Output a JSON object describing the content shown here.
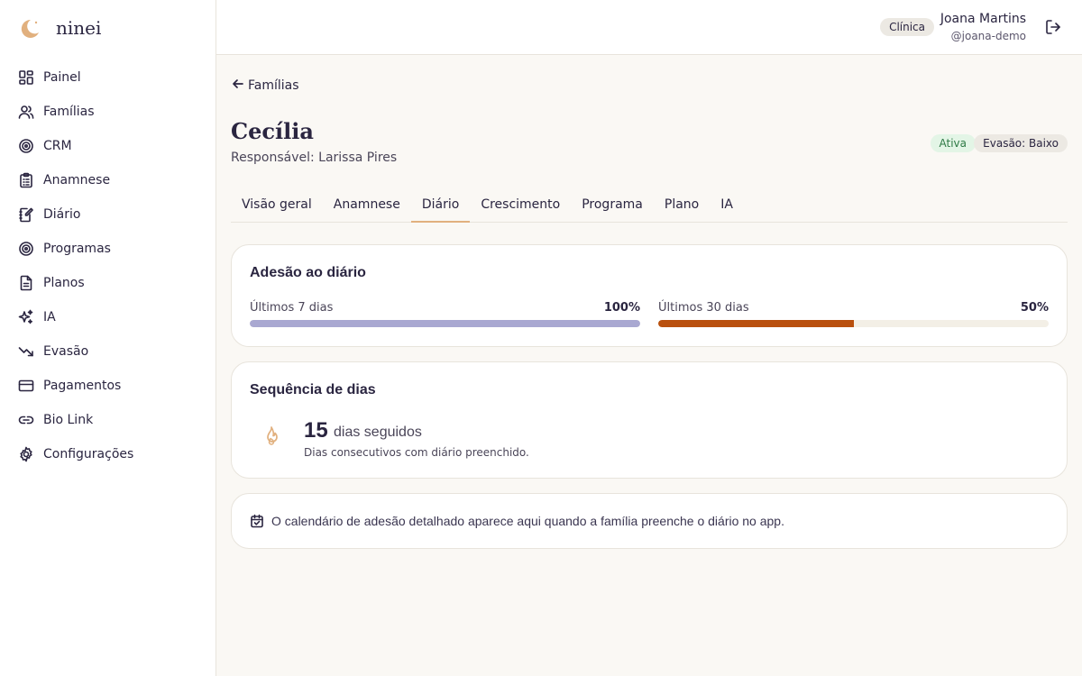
{
  "brand": {
    "name": "ninei",
    "logo_icon": "moon-logo-icon",
    "accent": "#e1b07e"
  },
  "sidebar": {
    "items": [
      {
        "label": "Painel",
        "icon": "dashboard-icon"
      },
      {
        "label": "Famílias",
        "icon": "users-icon"
      },
      {
        "label": "CRM",
        "icon": "target-icon"
      },
      {
        "label": "Anamnese",
        "icon": "clipboard-icon"
      },
      {
        "label": "Diário",
        "icon": "notebook-icon"
      },
      {
        "label": "Programas",
        "icon": "target-icon"
      },
      {
        "label": "Planos",
        "icon": "document-icon"
      },
      {
        "label": "IA",
        "icon": "sparkles-icon"
      },
      {
        "label": "Evasão",
        "icon": "trend-down-icon"
      },
      {
        "label": "Pagamentos",
        "icon": "credit-card-icon"
      },
      {
        "label": "Bio Link",
        "icon": "link-icon"
      },
      {
        "label": "Configurações",
        "icon": "gear-icon"
      }
    ]
  },
  "topbar": {
    "org_badge": "Clínica",
    "user_name": "Joana Martins",
    "user_handle": "@joana-demo",
    "logout_icon": "logout-icon"
  },
  "main": {
    "back_label": "Famílias",
    "title": "Cecília",
    "subtitle": "Responsável: Larissa Pires",
    "badges": {
      "status": "Ativa",
      "risk": "Evasão: Baixo",
      "status_color": "#2f7a45"
    },
    "tabs": [
      {
        "label": "Visão geral",
        "active": false
      },
      {
        "label": "Anamnese",
        "active": false
      },
      {
        "label": "Diário",
        "active": true
      },
      {
        "label": "Crescimento",
        "active": false
      },
      {
        "label": "Programa",
        "active": false
      },
      {
        "label": "Plano",
        "active": false
      },
      {
        "label": "IA",
        "active": false
      }
    ],
    "adhesion": {
      "title": "Adesão ao diário",
      "meters": [
        {
          "label": "Últimos 7 dias",
          "value": "100%",
          "fraction": 1.0,
          "color": "#a9a8d1"
        },
        {
          "label": "Últimos 30 dias",
          "value": "50%",
          "fraction": 0.5,
          "color": "#b9500e"
        }
      ]
    },
    "streak": {
      "title": "Sequência de dias",
      "count": "15",
      "unit": "dias seguidos",
      "description": "Dias consecutivos com diário preenchido.",
      "icon": "flame-icon",
      "icon_color": "#e1b07e"
    },
    "info": {
      "icon": "calendar-check-icon",
      "text": "O calendário de adesão detalhado aparece aqui quando a família preenche o diário no app."
    }
  }
}
